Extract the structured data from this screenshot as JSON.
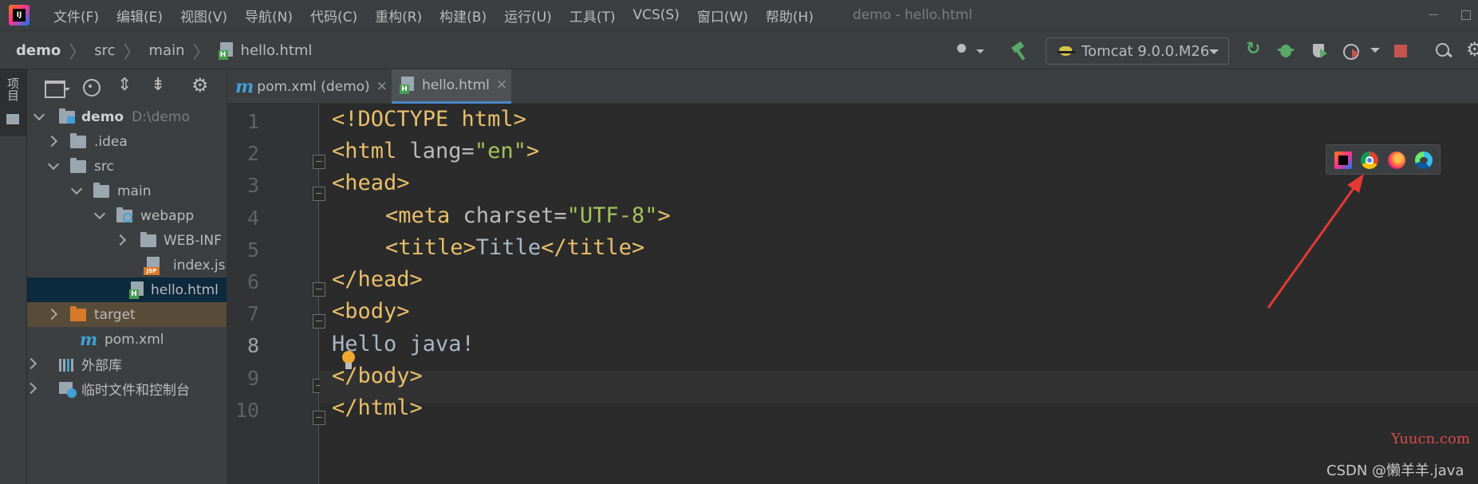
{
  "menubar": {
    "items": [
      "文件(F)",
      "编辑(E)",
      "视图(V)",
      "导航(N)",
      "代码(C)",
      "重构(R)",
      "构建(B)",
      "运行(U)",
      "工具(T)",
      "VCS(S)",
      "窗口(W)",
      "帮助(H)"
    ],
    "window_title": "demo - hello.html"
  },
  "breadcrumb": {
    "project": "demo",
    "dir1": "src",
    "dir2": "main",
    "file": "hello.html"
  },
  "toolbar": {
    "run_config": "Tomcat 9.0.0.M26"
  },
  "sidebar": {
    "project_tab_label": "项目"
  },
  "project_tree": {
    "root_label": "demo",
    "root_path": "D:\\demo",
    "items": [
      ".idea",
      "src",
      "main",
      "webapp",
      "WEB-INF",
      "index.jsp",
      "hello.html",
      "target",
      "pom.xml"
    ],
    "external_libraries": "外部库",
    "scratches": "临时文件和控制台"
  },
  "editor_tabs": [
    {
      "label": "pom.xml (demo)"
    },
    {
      "label": "hello.html"
    }
  ],
  "editor": {
    "line_numbers": [
      "1",
      "2",
      "3",
      "4",
      "5",
      "6",
      "7",
      "8",
      "9",
      "10"
    ],
    "current_line": 8,
    "code": {
      "l1": "<!DOCTYPE html>",
      "l2_open": "<html",
      "l2_attr": " lang=",
      "l2_val": "\"en\"",
      "l2_close": ">",
      "l3": "<head>",
      "l4_open": "<meta",
      "l4_attr": " charset=",
      "l4_val": "\"UTF-8\"",
      "l4_close": ">",
      "l5_open": "<title>",
      "l5_text": "Title",
      "l5_close": "</title>",
      "l6": "</head>",
      "l7": "<body>",
      "l8": "Hello java!",
      "l9": "</body>",
      "l10": "</html>"
    }
  },
  "browser_popup": {
    "browsers": [
      "intellij-icon",
      "chrome-icon",
      "firefox-icon",
      "edge-icon"
    ]
  },
  "watermarks": {
    "yuucn": "Yuucn.com",
    "csdn": "CSDN @懒羊羊.java"
  },
  "colors": {
    "tag": "#e8bf6a",
    "string": "#a5c25c",
    "attribute": "#bababa",
    "annotation_arrow": "#e53935"
  }
}
